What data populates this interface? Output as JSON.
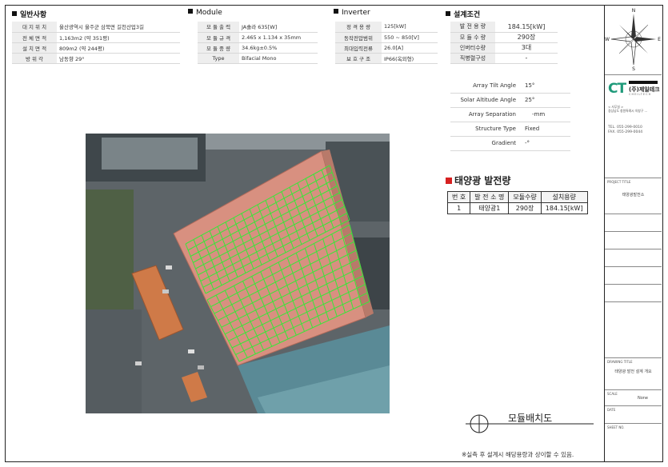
{
  "general": {
    "heading": "일반사항",
    "rows": [
      {
        "label": "대 지 위 치",
        "value": "울산광역시 울주군 삼북면 길천산업3길"
      },
      {
        "label": "전 체 면 적",
        "value": "1,163m2 (약 351평)"
      },
      {
        "label": "설 치 면 적",
        "value": "809m2 (약 244평)"
      },
      {
        "label": "방 위 각",
        "value": "남동향 29°"
      }
    ]
  },
  "module": {
    "heading": "Module",
    "rows": [
      {
        "label": "모 듈 출 력",
        "value": "JA솔라 635[W]"
      },
      {
        "label": "모 듈 규 격",
        "value": "2.465 x 1.134 x 35mm"
      },
      {
        "label": "모 듈 중 량",
        "value": "34.6kg±0.5%"
      },
      {
        "label": "Type",
        "value": "Bifacial Mono"
      }
    ]
  },
  "inverter": {
    "heading": "Inverter",
    "rows": [
      {
        "label": "정 격 용 량",
        "value": "125[kW]"
      },
      {
        "label": "동작전압범위",
        "value": "550 ~ 850[V]"
      },
      {
        "label": "최대입력전류",
        "value": "26.0[A]"
      },
      {
        "label": "보 호 구 조",
        "value": "IP66(옥외형)"
      }
    ]
  },
  "design": {
    "heading": "설계조건",
    "rows": [
      {
        "label": "발 전 용 량",
        "value": "184.15[kW]"
      },
      {
        "label": "모 듈 수 량",
        "value": "290장"
      },
      {
        "label": "인버터수량",
        "value": "3대"
      },
      {
        "label": "직병렬구성",
        "value": "-"
      }
    ],
    "rows2": [
      {
        "label": "Array Tilt Angle",
        "value": "15°"
      },
      {
        "label": "Solar Altitude Angle",
        "value": "25°"
      },
      {
        "label": "Array Separation",
        "value": "-mm"
      },
      {
        "label": "Structure Type",
        "value": "Fixed"
      },
      {
        "label": "Gradient",
        "value": "-°"
      }
    ]
  },
  "generation": {
    "title": "태양광 발전량",
    "headers": [
      "번 호",
      "발 전 소 명",
      "모듈수량",
      "설치용량"
    ],
    "rows": [
      {
        "no": "1",
        "name": "태양광1",
        "qty": "290장",
        "capacity": "184.15[kW]"
      }
    ]
  },
  "drawing": {
    "label": "모듈배치도",
    "footnote": "※실측 후 설계시 해당용량과 상이할 수 있음."
  },
  "compass": {
    "n": "N",
    "s": "S",
    "e": "E",
    "w": "W"
  },
  "company": {
    "logo_letters": "CT",
    "name": "(주)제일테크",
    "english": "CHEILTECH",
    "address_label": "< 사무실 >",
    "address": "경상남도 창원특례시 의창구 ...",
    "tel": "TEL. 055-299-0010",
    "fax": "FAX. 055-299-0044"
  },
  "titleblock": {
    "project_label": "PROJECT TITLE",
    "project_value": "태양광발전소",
    "drawing_label": "DRAWING TITLE",
    "drawing_value": "태양광 발전 설계 개요",
    "scale_label": "SCALE",
    "scale_value": "None",
    "date_label": "DATE",
    "sheet_label": "SHEET NO."
  },
  "colors": {
    "module_grid": "#39e639",
    "roof": "#d89080",
    "accent": "#d62020",
    "logo": "#1f9a7a"
  }
}
